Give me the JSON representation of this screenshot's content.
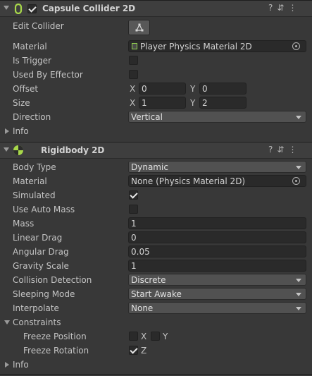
{
  "capsule": {
    "title": "Capsule Collider 2D",
    "icon": "capsule-collider-icon",
    "edit_collider_label": "Edit Collider",
    "material_label": "Material",
    "material_value": "Player Physics Material 2D",
    "is_trigger_label": "Is Trigger",
    "is_trigger": false,
    "used_by_effector_label": "Used By Effector",
    "used_by_effector": false,
    "offset_label": "Offset",
    "offset_x": "0",
    "offset_y": "0",
    "size_label": "Size",
    "size_x": "1",
    "size_y": "2",
    "direction_label": "Direction",
    "direction_value": "Vertical",
    "info_label": "Info",
    "axis_x": "X",
    "axis_y": "Y"
  },
  "rigidbody": {
    "title": "Rigidbody 2D",
    "icon": "rigidbody-icon",
    "body_type_label": "Body Type",
    "body_type_value": "Dynamic",
    "material_label": "Material",
    "material_value": "None (Physics Material 2D)",
    "simulated_label": "Simulated",
    "simulated": true,
    "use_auto_mass_label": "Use Auto Mass",
    "use_auto_mass": false,
    "mass_label": "Mass",
    "mass_value": "1",
    "linear_drag_label": "Linear Drag",
    "linear_drag_value": "0",
    "angular_drag_label": "Angular Drag",
    "angular_drag_value": "0.05",
    "gravity_scale_label": "Gravity Scale",
    "gravity_scale_value": "1",
    "collision_detection_label": "Collision Detection",
    "collision_detection_value": "Discrete",
    "sleeping_mode_label": "Sleeping Mode",
    "sleeping_mode_value": "Start Awake",
    "interpolate_label": "Interpolate",
    "interpolate_value": "None",
    "constraints_label": "Constraints",
    "freeze_position_label": "Freeze Position",
    "freeze_position_x": false,
    "freeze_position_y": false,
    "freeze_rotation_label": "Freeze Rotation",
    "freeze_rotation_z": true,
    "axis_x": "X",
    "axis_y": "Y",
    "axis_z": "Z",
    "info_label": "Info"
  },
  "header_icons": [
    "help-icon",
    "preset-icon",
    "more-icon"
  ],
  "colors": {
    "background": "#383838",
    "header": "#3e3e3e",
    "field": "#2a2a2a",
    "dropdown": "#515151",
    "accent_green": "#a8d84a"
  }
}
